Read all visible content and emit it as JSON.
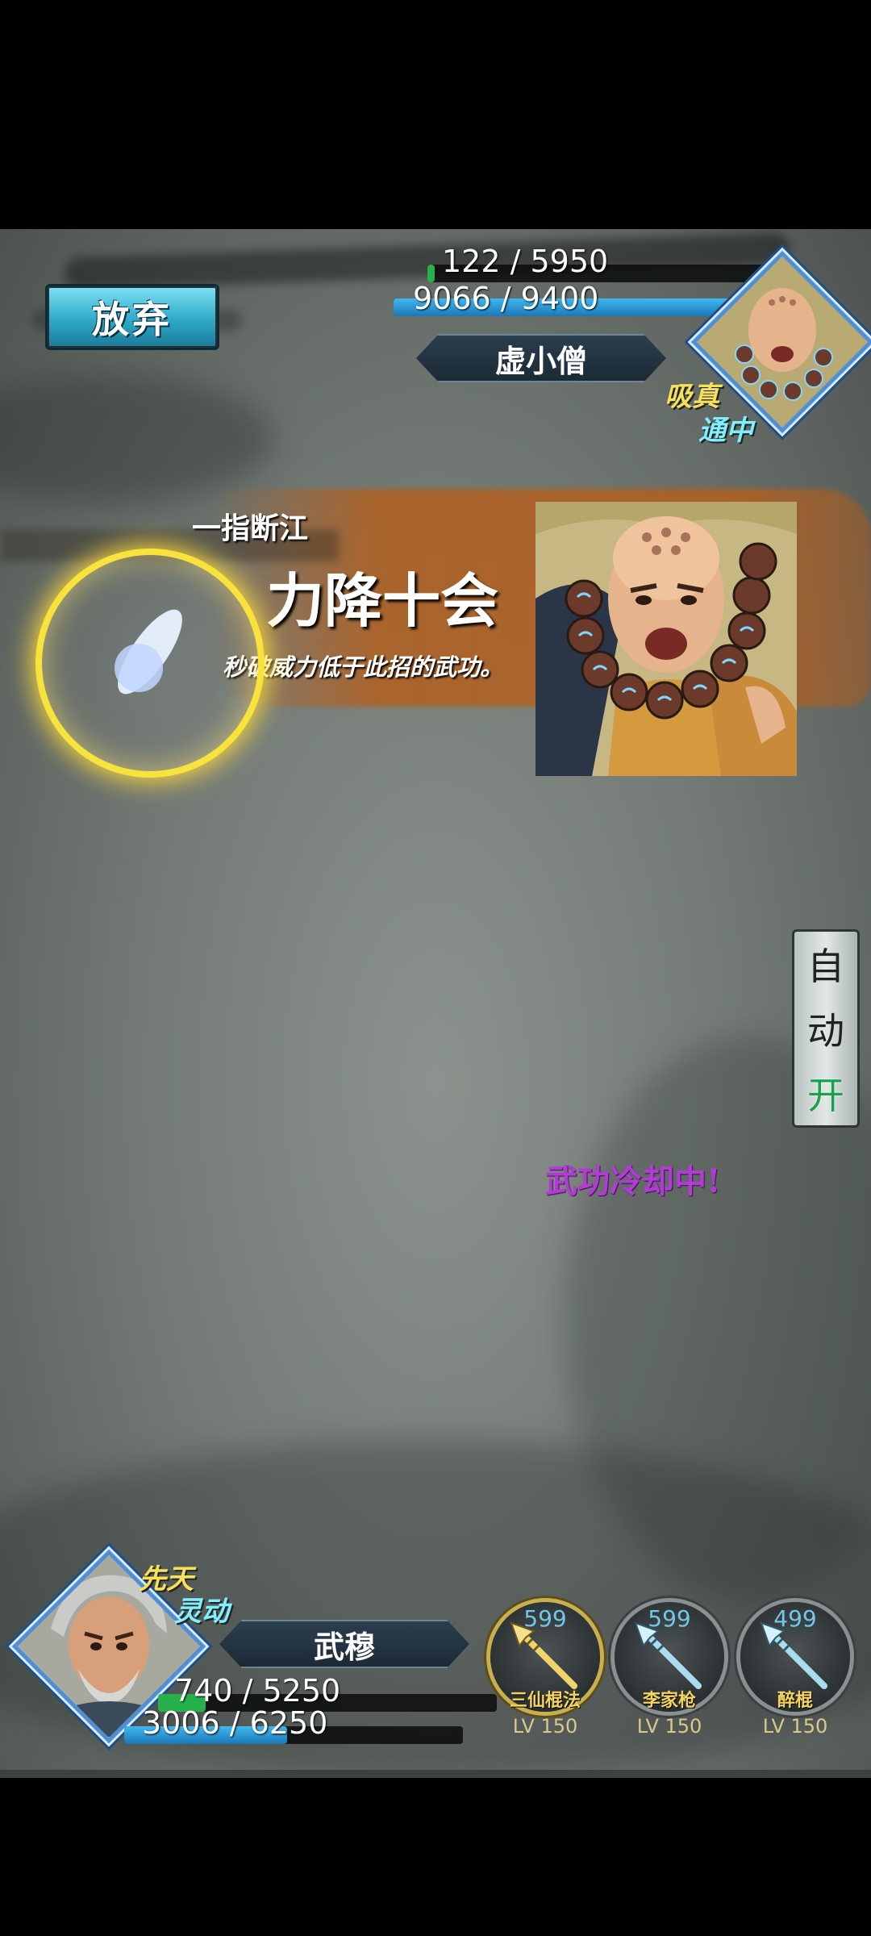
{
  "enemy": {
    "hp_text": "122 / 5950",
    "hp_fraction": 0.0205,
    "mp_text": "9066 / 9400",
    "mp_fraction": 0.964,
    "name": "虚小僧",
    "status1": "吸真",
    "status2": "通中"
  },
  "buttons": {
    "abandon": "放弃"
  },
  "skill_banner": {
    "caption": "一指断江",
    "title": "力降十会",
    "description": "秒破威力低于此招的武功。"
  },
  "auto_button": {
    "line1": "自",
    "line2": "动",
    "state": "开"
  },
  "message": "武功冷却中!",
  "player": {
    "name": "武穆",
    "status1": "先天",
    "status2": "灵动",
    "hp_text": "740 / 5250",
    "hp_fraction": 0.141,
    "mp_text": "3006 / 6250",
    "mp_fraction": 0.481
  },
  "skills": [
    {
      "count": "599",
      "name": "三仙棍法",
      "level": "LV 150",
      "icon": "gold-spear-icon"
    },
    {
      "count": "599",
      "name": "李家枪",
      "level": "LV 150",
      "icon": "spear-icon"
    },
    {
      "count": "499",
      "name": "醉棍",
      "level": "LV 150",
      "icon": "spear-icon"
    }
  ],
  "colors": {
    "hp": "#27b14a",
    "mp": "#1f8fd0",
    "status_yellow": "#f6e25a",
    "status_cyan": "#7ff0ff",
    "message": "#b23bd6",
    "auto_on": "#1aa14a"
  }
}
